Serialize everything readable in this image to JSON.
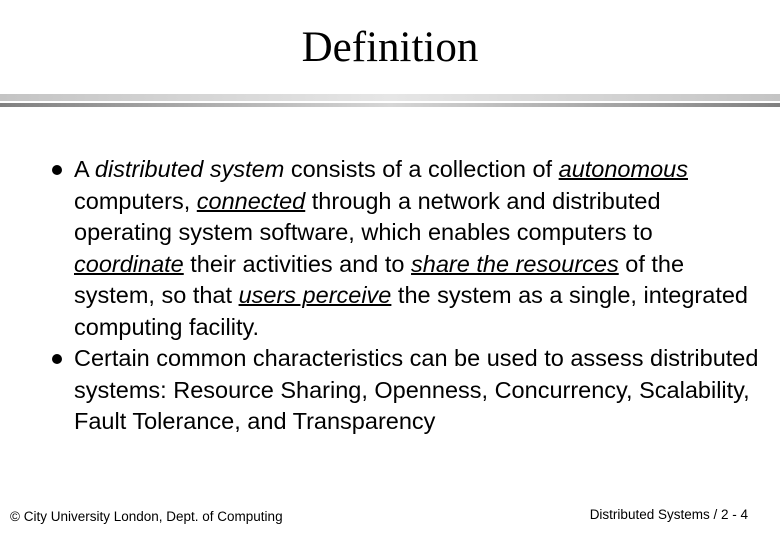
{
  "slide": {
    "title": "Definition",
    "bullets": [
      {
        "segments": [
          {
            "text": "A ",
            "style": "plain"
          },
          {
            "text": "distributed system",
            "style": "italic"
          },
          {
            "text": "  consists of a collection of ",
            "style": "plain"
          },
          {
            "text": "autonomous",
            "style": "italic-underline"
          },
          {
            "text": " computers, ",
            "style": "plain"
          },
          {
            "text": "connected",
            "style": "italic-underline"
          },
          {
            "text": " through a network and distributed operating system software, which enables computers to ",
            "style": "plain"
          },
          {
            "text": "coordinate",
            "style": "italic-underline"
          },
          {
            "text": " their activities and to ",
            "style": "plain"
          },
          {
            "text": "share the resources",
            "style": "italic-underline"
          },
          {
            "text": " of the system, so that ",
            "style": "plain"
          },
          {
            "text": "users perceive",
            "style": "italic-underline"
          },
          {
            "text": " the system as a single, integrated computing facility.",
            "style": "plain"
          }
        ]
      },
      {
        "segments": [
          {
            "text": "Certain common characteristics can be used to assess distributed systems: Resource Sharing, Openness, Concurrency, Scalability, Fault Tolerance, and Transparency",
            "style": "plain"
          }
        ]
      }
    ],
    "footer_left": "© City University London, Dept. of Computing",
    "footer_right": "Distributed Systems / 2 - 4"
  }
}
